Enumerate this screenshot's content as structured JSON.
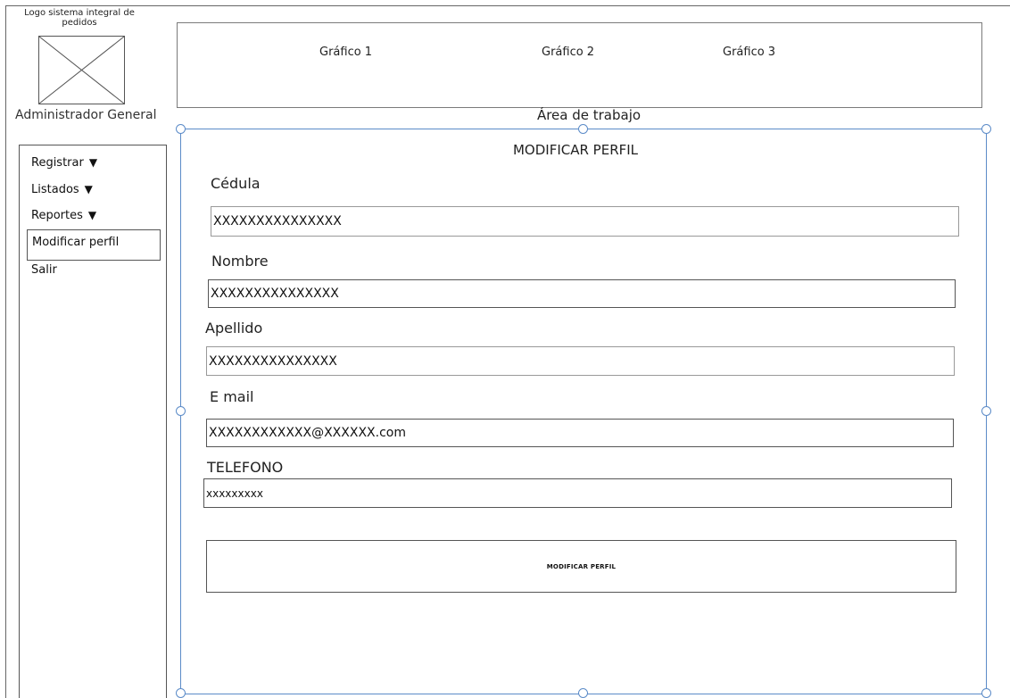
{
  "logo": {
    "caption_line1": "Logo sistema integral de",
    "caption_line2": "pedidos",
    "placeholder_icon": "image-placeholder-icon"
  },
  "user_role": "Administrador General",
  "charts": [
    "Gráfico 1",
    "Gráfico 2",
    "Gráfico 3"
  ],
  "work_area_label": "Área de trabajo",
  "sidebar": {
    "items": [
      {
        "label": "Registrar",
        "caret": "▼"
      },
      {
        "label": "Listados",
        "caret": "▼"
      },
      {
        "label": "Reportes",
        "caret": "▼"
      },
      {
        "label": "Modificar perfil"
      },
      {
        "label": "Salir"
      }
    ]
  },
  "form": {
    "title": "MODIFICAR PERFIL",
    "fields": [
      {
        "label": "Cédula",
        "value": "XXXXXXXXXXXXXXX"
      },
      {
        "label": "Nombre",
        "value": "XXXXXXXXXXXXXXX"
      },
      {
        "label": "Apellido",
        "value": "XXXXXXXXXXXXXXX"
      },
      {
        "label": "E mail",
        "value": "XXXXXXXXXXXX@XXXXXX.com"
      },
      {
        "label": "TELEFONO",
        "value": "xxxxxxxxx"
      }
    ],
    "submit_label": "MODIFICAR PERFIL"
  },
  "colors": {
    "selection": "#5b8bc8",
    "border": "#555555"
  }
}
